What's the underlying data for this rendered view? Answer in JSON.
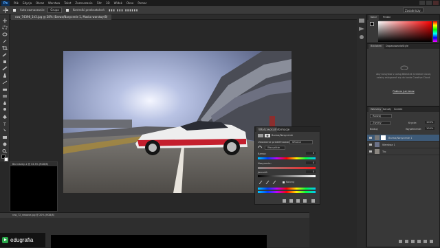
{
  "menu": {
    "app_badge": "Ps",
    "items": [
      "Plik",
      "Edycja",
      "Obraz",
      "Warstwa",
      "Tekst",
      "Zaznaczanie",
      "Filtr",
      "3D",
      "Widok",
      "Okno",
      "Pomoc"
    ]
  },
  "options": {
    "auto_select_label": "Auto zaznaczanie:",
    "auto_select_value": "Grupa",
    "transform_label": "Kontrolki przekształceń",
    "workspace_value": "Zasadniczy"
  },
  "document": {
    "tab_label": "raw_74398_1h3.jpg @ 28% (Barwa/Nasycenie 1, Maska warstwy/8)"
  },
  "properties_panel": {
    "tab_properties": "Właściwości",
    "tab_info": "Informacje",
    "title": "Barwa/Nasycenie",
    "preset_label": "Ustawienie predefiniowane:",
    "preset_value": "Własne",
    "channel_value": "Wszystkie",
    "hue_label": "Barwa:",
    "hue_value": "0",
    "saturation_label": "Nasycenie:",
    "saturation_value": "0",
    "lightness_label": "Jasność:",
    "lightness_value": "0",
    "colorize_label": "Koloruj"
  },
  "color_panel": {
    "tab_color": "Kolor",
    "tab_swatches": "Próbki"
  },
  "libraries_panel": {
    "tab_libraries": "Biblioteki",
    "tab_adjustments": "Dopasowania",
    "tab_styles": "Style",
    "message": "Aby korzystać z usług Bibliotek Creative Cloud, należy zalogować się do konta Creative Cloud.",
    "button": "Pobierz już teraz"
  },
  "layers_panel": {
    "tab_layers": "Warstwy",
    "tab_channels": "Kanały",
    "tab_paths": "Ścieżki",
    "filter_label": "Rodzaj",
    "blend_mode": "Zwykły",
    "opacity_label": "Krycie:",
    "opacity_value": "100%",
    "lock_label": "Blokuj:",
    "fill_label": "Wypełnienie:",
    "fill_value": "100%",
    "layers": [
      {
        "name": "Barwa/Nasycenie 1"
      },
      {
        "name": "Warstwa 1"
      },
      {
        "name": "Tło"
      }
    ]
  },
  "second_document": {
    "tab_label": "Bez nazwy-1 @ 33.3% (RGB/8)"
  },
  "third_document": {
    "tab_label": "raw_72_smoove.jpg @ 20% (RGB/8)"
  },
  "watermark": {
    "brand": "edugrafia"
  },
  "colors": {
    "accent_blue": "#2d8ceb",
    "selected_layer": "#3d5a78",
    "brand_green": "#2aa84a"
  }
}
